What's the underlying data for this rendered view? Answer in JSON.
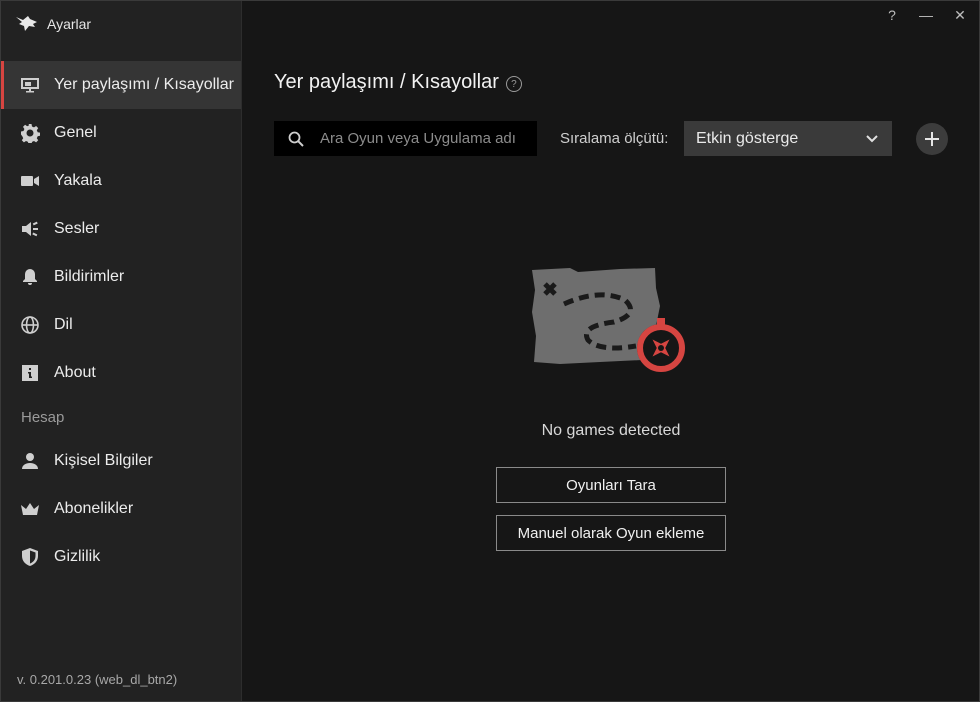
{
  "window": {
    "title": "Ayarlar",
    "controls": {
      "help": "?",
      "minimize": "—",
      "close": "✕"
    }
  },
  "sidebar": {
    "items": [
      {
        "label": "Yer paylaşımı / Kısayollar",
        "icon": "overlay-monitor-icon",
        "active": true
      },
      {
        "label": "Genel",
        "icon": "gear-icon"
      },
      {
        "label": "Yakala",
        "icon": "video-camera-icon"
      },
      {
        "label": "Sesler",
        "icon": "speaker-icon"
      },
      {
        "label": "Bildirimler",
        "icon": "bell-icon"
      },
      {
        "label": "Dil",
        "icon": "globe-icon"
      },
      {
        "label": "About",
        "icon": "info-icon"
      }
    ],
    "section_account": "Hesap",
    "account_items": [
      {
        "label": "Kişisel Bilgiler",
        "icon": "user-icon"
      },
      {
        "label": "Abonelikler",
        "icon": "crown-icon"
      },
      {
        "label": "Gizlilik",
        "icon": "shield-icon"
      }
    ],
    "version": "v. 0.201.0.23 (web_dl_btn2)"
  },
  "main": {
    "title": "Yer paylaşımı / Kısayollar",
    "search": {
      "placeholder": "Ara Oyun veya Uygulama adı",
      "value": ""
    },
    "sort": {
      "label": "Sıralama ölçütü:",
      "selected": "Etkin gösterge"
    },
    "empty": {
      "message": "No games detected",
      "scan_button": "Oyunları Tara",
      "manual_button": "Manuel olarak Oyun ekleme"
    }
  },
  "colors": {
    "accent": "#d64541",
    "sidebar_bg": "#222222",
    "main_bg": "#161616",
    "active_bg": "#353535"
  }
}
